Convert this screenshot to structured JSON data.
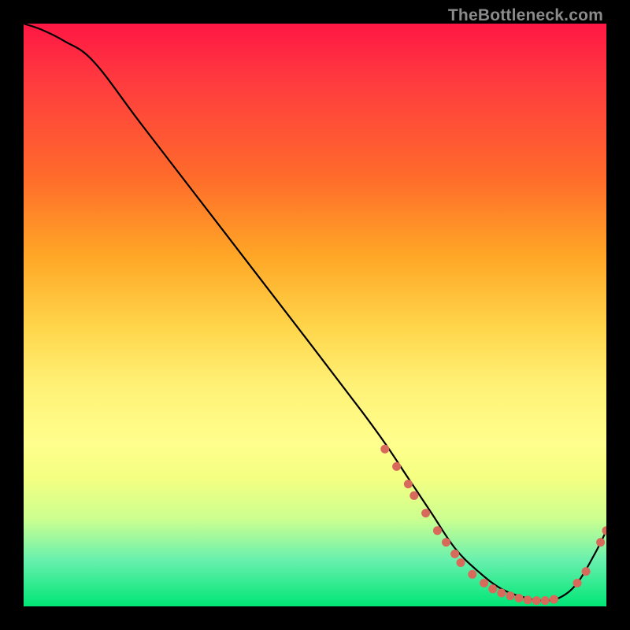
{
  "watermark": "TheBottleneck.com",
  "colors": {
    "dot": "#d86a5c",
    "line": "#000000"
  },
  "chart_data": {
    "type": "line",
    "title": "",
    "xlabel": "",
    "ylabel": "",
    "xlim": [
      0,
      100
    ],
    "ylim": [
      0,
      100
    ],
    "grid": false,
    "legend": false,
    "note": "V-shaped bottleneck curve; y is bottleneck percentage (lower is better). Dots mark measured sample points near the minimum and at the tail.",
    "series": [
      {
        "name": "bottleneck-curve",
        "x": [
          0,
          3,
          7,
          12,
          20,
          30,
          40,
          50,
          58,
          62,
          66,
          70,
          74,
          78,
          82,
          86,
          89,
          92,
          95,
          98,
          100
        ],
        "y": [
          100,
          99,
          97,
          93.5,
          83,
          70,
          57,
          44,
          33.5,
          28,
          22,
          16,
          10,
          6,
          3,
          1.5,
          1,
          1.5,
          4,
          9,
          13
        ]
      }
    ],
    "points": [
      {
        "x": 62,
        "y": 27
      },
      {
        "x": 64,
        "y": 24
      },
      {
        "x": 66,
        "y": 21
      },
      {
        "x": 67,
        "y": 19
      },
      {
        "x": 69,
        "y": 16
      },
      {
        "x": 71,
        "y": 13
      },
      {
        "x": 72.5,
        "y": 11
      },
      {
        "x": 74,
        "y": 9
      },
      {
        "x": 75,
        "y": 7.5
      },
      {
        "x": 77,
        "y": 5.5
      },
      {
        "x": 79,
        "y": 4
      },
      {
        "x": 80.5,
        "y": 3
      },
      {
        "x": 82,
        "y": 2.3
      },
      {
        "x": 83.5,
        "y": 1.8
      },
      {
        "x": 85,
        "y": 1.4
      },
      {
        "x": 86.5,
        "y": 1.1
      },
      {
        "x": 88,
        "y": 1
      },
      {
        "x": 89.5,
        "y": 1
      },
      {
        "x": 91,
        "y": 1.2
      },
      {
        "x": 95,
        "y": 4
      },
      {
        "x": 96.5,
        "y": 6
      },
      {
        "x": 99,
        "y": 11
      },
      {
        "x": 100,
        "y": 13
      }
    ]
  }
}
